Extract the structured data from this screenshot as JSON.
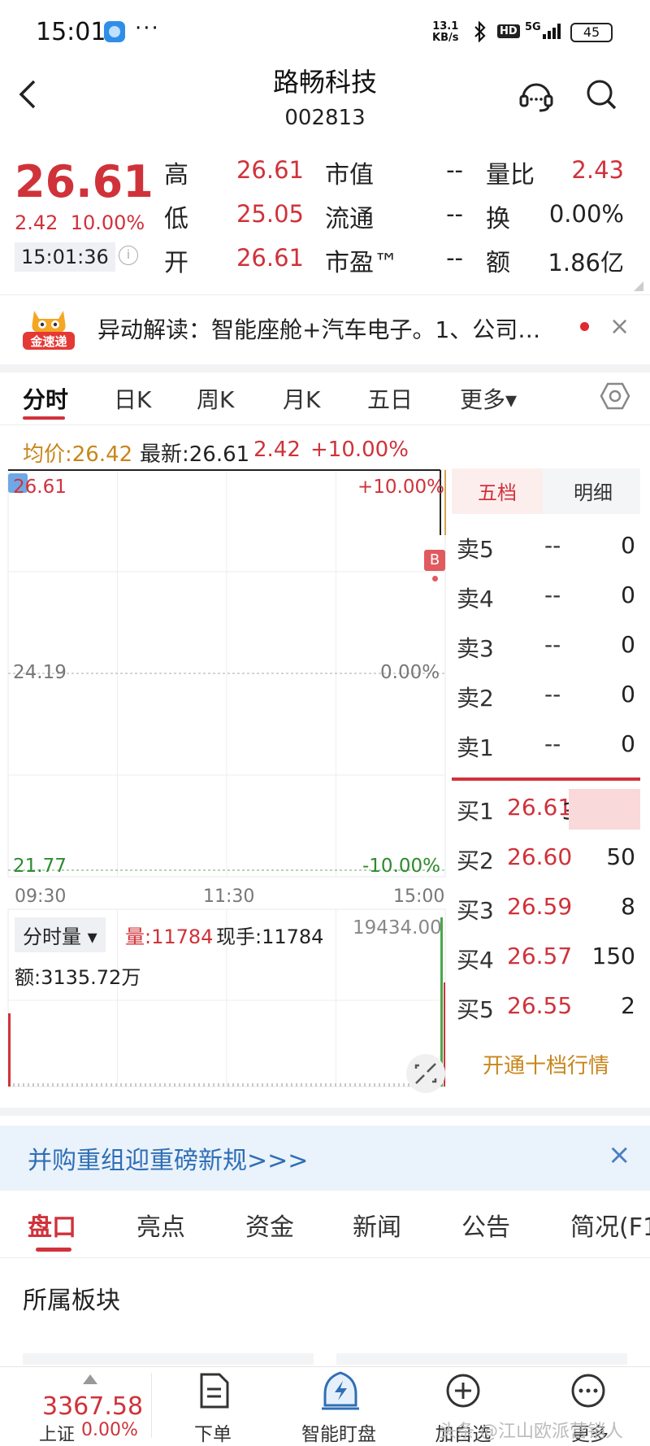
{
  "status_bar": {
    "time": "15:01",
    "dots": "···",
    "net_speed_top": "13.1",
    "net_speed_bottom": "KB/s",
    "hd": "HD",
    "signal": "5G",
    "battery": "45"
  },
  "header": {
    "name": "路畅科技",
    "code": "002813"
  },
  "quote": {
    "price": "26.61",
    "change": "2.42",
    "change_pct": "10.00%",
    "time": "15:01:36",
    "info_glyph": "i",
    "rows": [
      {
        "l1": "高",
        "v1": "26.61",
        "l2": "市值",
        "v2": "--",
        "l3": "量比",
        "v3": "2.43"
      },
      {
        "l1": "低",
        "v1": "25.05",
        "l2": "流通",
        "v2": "--",
        "l3": "换",
        "v3": "0.00%"
      },
      {
        "l1": "开",
        "v1": "26.61",
        "l2": "市盈™",
        "v2": "--",
        "l3": "额",
        "v3": "1.86亿"
      }
    ]
  },
  "banner": {
    "logo_text": "金速递",
    "text": "异动解读：智能座舱+汽车电子。1、公司…",
    "close": "×"
  },
  "chart_tabs": [
    "分时",
    "日K",
    "周K",
    "月K",
    "五日",
    "更多▾"
  ],
  "legend": {
    "avg": "均价:26.42",
    "latest": "最新:26.61",
    "change": "2.42",
    "pct": "+10.00%"
  },
  "chart_data": {
    "type": "line",
    "y_left_ticks": [
      "26.61",
      "24.19",
      "21.77"
    ],
    "y_right_ticks": [
      "+10.00%",
      "0.00%",
      "-10.00%"
    ],
    "x_ticks": [
      "09:30",
      "11:30",
      "15:00"
    ],
    "ylim": [
      21.77,
      26.61
    ],
    "marker": "B",
    "series": [
      {
        "name": "",
        "x": [
          "09:30",
          "15:00"
        ],
        "values": [
          26.61,
          26.61
        ]
      }
    ],
    "volume": {
      "selector": "分时量",
      "vol": "量:11784",
      "hand": "现手:11784",
      "max": "19434.00",
      "amount": "额:3135.72万"
    }
  },
  "order_book": {
    "tabs": [
      "五档",
      "明细"
    ],
    "asks": [
      {
        "label": "卖5",
        "price": "--",
        "vol": "0"
      },
      {
        "label": "卖4",
        "price": "--",
        "vol": "0"
      },
      {
        "label": "卖3",
        "price": "--",
        "vol": "0"
      },
      {
        "label": "卖2",
        "price": "--",
        "vol": "0"
      },
      {
        "label": "卖1",
        "price": "--",
        "vol": "0"
      }
    ],
    "bids": [
      {
        "label": "买1",
        "price": "26.61",
        "vol": "3.14万"
      },
      {
        "label": "买2",
        "price": "26.60",
        "vol": "50"
      },
      {
        "label": "买3",
        "price": "26.59",
        "vol": "8"
      },
      {
        "label": "买4",
        "price": "26.57",
        "vol": "150"
      },
      {
        "label": "买5",
        "price": "26.55",
        "vol": "2"
      }
    ],
    "open_level10": "开通十档行情"
  },
  "promo": {
    "text": "并购重组迎重磅新规>>>",
    "close": "×"
  },
  "bottom_tabs": [
    "盘口",
    "亮点",
    "资金",
    "新闻",
    "公告",
    "简况(F1"
  ],
  "section_title": "所属板块",
  "nav": {
    "index_value": "3367.58",
    "index_name": "上证",
    "index_change": "0.00%",
    "items": [
      "下单",
      "智能盯盘",
      "加自选",
      "更多"
    ],
    "watermark": "头条 @江山欧派营销人"
  },
  "colors": {
    "up": "#d0323a",
    "down": "#2e8b2e",
    "avg": "#c8861a",
    "link": "#2f6fb5"
  }
}
